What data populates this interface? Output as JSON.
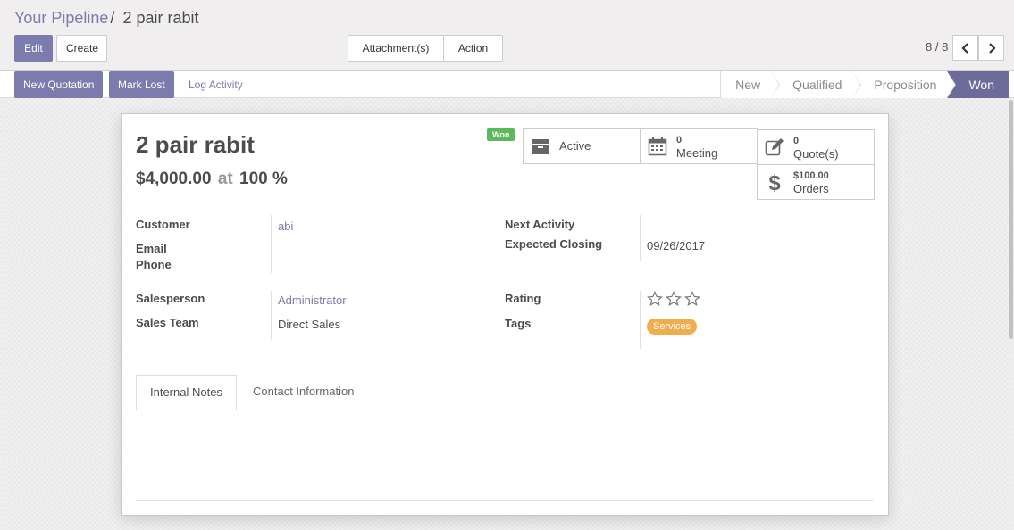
{
  "breadcrumb": {
    "parent": "Your Pipeline",
    "separator": "/",
    "current": "2 pair rabit"
  },
  "toolbar": {
    "edit": "Edit",
    "create": "Create",
    "attachments": "Attachment(s)",
    "action": "Action"
  },
  "pager": {
    "value": "8 / 8"
  },
  "statusbar": {
    "new_quotation": "New Quotation",
    "mark_lost": "Mark Lost",
    "log_activity": "Log Activity",
    "stages": [
      "New",
      "Qualified",
      "Proposition",
      "Won"
    ],
    "current_stage": "Won"
  },
  "ribbon": "Won",
  "smart_buttons": {
    "active": {
      "label": "Active"
    },
    "meeting": {
      "count": "0",
      "label": "Meeting"
    },
    "quotes": {
      "count": "0",
      "label": "Quote(s)"
    },
    "orders": {
      "amount": "$100.00",
      "label": "Orders"
    }
  },
  "lead": {
    "name": "2 pair rabit",
    "revenue": "$4,000.00",
    "at": "at",
    "probability": "100 %"
  },
  "fields": {
    "customer": {
      "label": "Customer",
      "value": "abi"
    },
    "email": {
      "label": "Email",
      "value": ""
    },
    "phone": {
      "label": "Phone",
      "value": ""
    },
    "salesperson": {
      "label": "Salesperson",
      "value": "Administrator"
    },
    "sales_team": {
      "label": "Sales Team",
      "value": "Direct Sales"
    },
    "next_activity": {
      "label": "Next Activity",
      "value": ""
    },
    "expected_closing": {
      "label": "Expected Closing",
      "value": "09/26/2017"
    },
    "rating": {
      "label": "Rating",
      "stars": 3,
      "filled": 0
    },
    "tags": {
      "label": "Tags",
      "values": [
        "Services"
      ]
    }
  },
  "tabs": [
    "Internal Notes",
    "Contact Information"
  ],
  "colors": {
    "primary": "#7c7bad",
    "won_badge": "#5cb85c",
    "tag": "#f0ad4e",
    "active_stage": "#6c6b9a"
  }
}
